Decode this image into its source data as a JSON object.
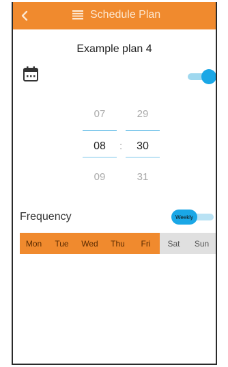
{
  "header": {
    "title": "Schedule Plan",
    "back_icon": "chevron-left-icon",
    "menu_icon": "list-icon",
    "bar_color": "#f08a2e"
  },
  "plan": {
    "name": "Example plan 4"
  },
  "schedule": {
    "calendar_icon": "calendar-icon",
    "enabled": true,
    "toggle_color": "#1aa7e6"
  },
  "time_picker": {
    "hours": {
      "prev": "07",
      "selected": "08",
      "next": "09"
    },
    "minutes": {
      "prev": "29",
      "selected": "30",
      "next": "31"
    },
    "separator": ":"
  },
  "frequency": {
    "label": "Frequency",
    "mode_label": "Weekly"
  },
  "days": [
    {
      "label": "Mon",
      "selected": true
    },
    {
      "label": "Tue",
      "selected": true
    },
    {
      "label": "Wed",
      "selected": true
    },
    {
      "label": "Thu",
      "selected": true
    },
    {
      "label": "Fri",
      "selected": true
    },
    {
      "label": "Sat",
      "selected": false
    },
    {
      "label": "Sun",
      "selected": false
    }
  ]
}
